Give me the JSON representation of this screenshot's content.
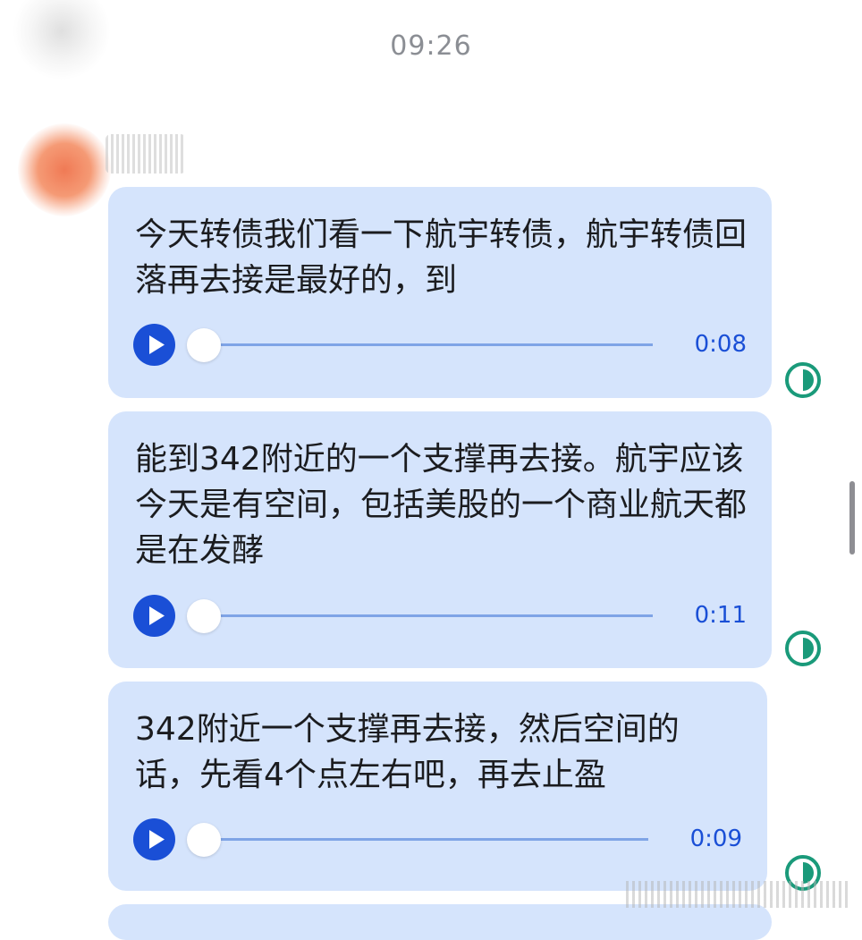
{
  "conversation": {
    "timestamp": "09:26"
  },
  "messages": [
    {
      "text": "今天转债我们看一下航宇转债，航宇转债回落再去接是最好的，到",
      "duration": "0:08"
    },
    {
      "text": "能到342附近的一个支撑再去接。航宇应该今天是有空间，包括美股的一个商业航天都是在发酵",
      "duration": "0:11"
    },
    {
      "text": "342附近一个支撑再去接，然后空间的话，先看4个点左右吧，再去止盈",
      "duration": "0:09"
    }
  ],
  "icons": {
    "play": "play-icon",
    "status": "read-status-icon"
  },
  "colors": {
    "bubble": "#d5e4fc",
    "accent": "#1a4fd6",
    "status": "#1a9a7a"
  }
}
